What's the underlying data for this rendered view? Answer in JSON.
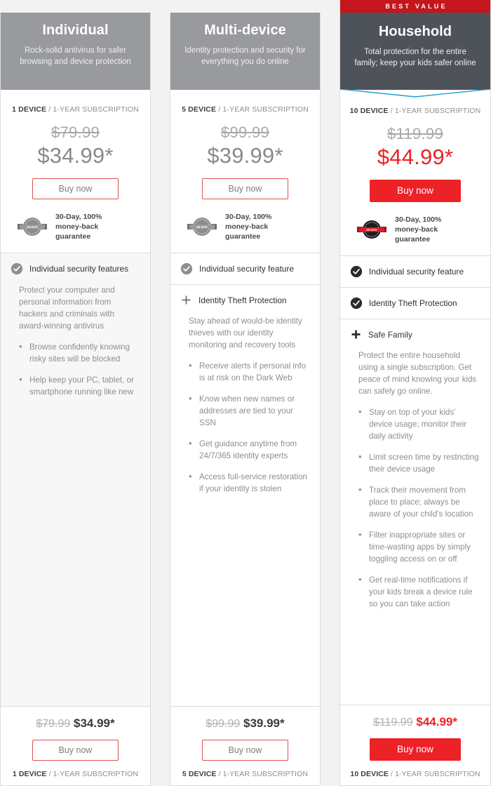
{
  "colors": {
    "best_value_banner": "#c4161c",
    "header_standard": "#989a9e",
    "header_featured": "#4e535a",
    "accent_red": "#ec2227",
    "notch_blue": "#1f9ed4",
    "muted_text": "#8e8e8e"
  },
  "best_value_label": "BEST VALUE",
  "plans": [
    {
      "id": "individual",
      "name": "Individual",
      "tagline": "Rock-solid antivirus for safer browsing and device protection",
      "devices_label": "1 DEVICE",
      "subscription_label": "/ 1-YEAR SUBSCRIPTION",
      "old_price": "$79.99",
      "new_price": "$34.99*",
      "buy_label": "Buy now",
      "guarantee_line1": "30-Day, 100%",
      "guarantee_line2": "money-back guarantee",
      "seal_label": "30 DAY",
      "featured": false,
      "feature_groups": [
        {
          "icon": "check-icon",
          "title": "Individual security features",
          "open": true,
          "description": "Protect your computer and personal information from hackers and criminals with award-winning antivirus",
          "bullets": [
            "Browse confidently knowing risky sites will be blocked",
            "Help keep your PC, tablet, or smartphone running like new"
          ]
        }
      ]
    },
    {
      "id": "multi",
      "name": "Multi-device",
      "tagline": "Identity protection and security for everything you do online",
      "devices_label": "5 DEVICE",
      "subscription_label": "/ 1-YEAR SUBSCRIPTION",
      "old_price": "$99.99",
      "new_price": "$39.99*",
      "buy_label": "Buy now",
      "guarantee_line1": "30-Day, 100%",
      "guarantee_line2": "money-back guarantee",
      "seal_label": "30 DAY",
      "featured": false,
      "feature_groups": [
        {
          "icon": "check-icon",
          "title": "Individual security feature",
          "open": false,
          "description": "",
          "bullets": []
        },
        {
          "icon": "plus-icon",
          "title": "Identity Theft Protection",
          "open": true,
          "description": "Stay ahead of would-be identity thieves with our identity monitoring and recovery tools",
          "bullets": [
            "Receive alerts if personal info is at risk on the Dark Web",
            "Know when new names or addresses are tied to your SSN",
            "Get guidance anytime from 24/7/365 identity experts",
            "Access full-service restoration if your identity is stolen"
          ]
        }
      ]
    },
    {
      "id": "household",
      "name": "Household",
      "tagline": "Total protection for the entire family; keep your kids safer online",
      "devices_label": "10 DEVICE",
      "subscription_label": "/ 1-YEAR SUBSCRIPTION",
      "old_price": "$119.99",
      "new_price": "$44.99*",
      "buy_label": "Buy now",
      "guarantee_line1": "30-Day, 100%",
      "guarantee_line2": "money-back guarantee",
      "seal_label": "30 DAY",
      "featured": true,
      "feature_groups": [
        {
          "icon": "check-icon",
          "title": "Individual security feature",
          "open": false,
          "description": "",
          "bullets": []
        },
        {
          "icon": "check-icon",
          "title": "Identity Theft Protection",
          "open": false,
          "description": "",
          "bullets": []
        },
        {
          "icon": "plus-icon",
          "title": "Safe Family",
          "open": true,
          "description": "Protect the entire household using a single subscription. Get peace of mind knowing your kids can safely go online.",
          "bullets": [
            "Stay on top of your kids' device usage; monitor their daily activity",
            "Limit screen time by restricting their device usage",
            "Track their movement from place to place; always be aware of your child's location",
            "Filter inappropriate sites or time-wasting apps by simply toggling access on or off",
            "Get real-time notifications if your kids break a device rule so you can take action"
          ]
        }
      ]
    }
  ]
}
